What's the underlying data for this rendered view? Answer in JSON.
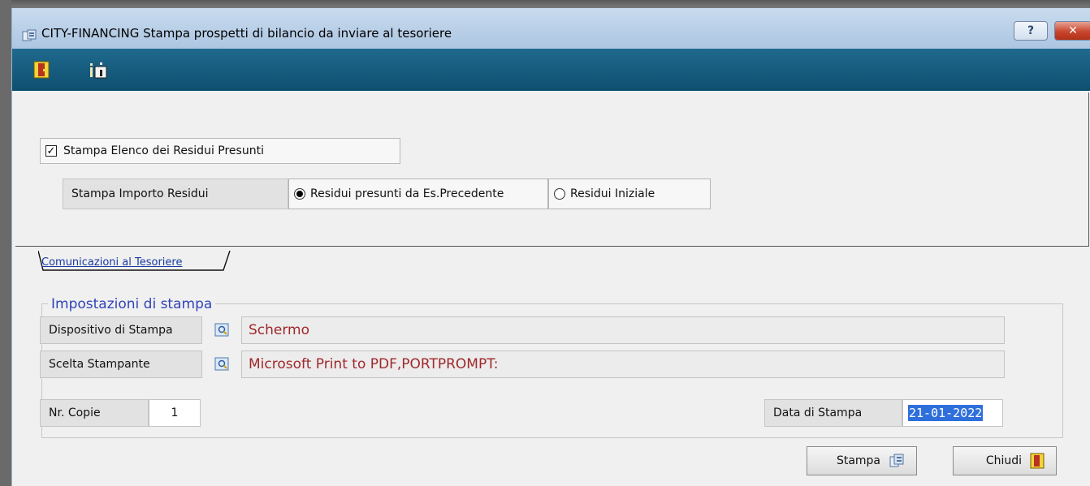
{
  "window": {
    "title": "CITY-FINANCING  Stampa prospetti di bilancio da inviare al tesoriere",
    "help_label": "?",
    "close_label": "✕"
  },
  "toolbar": {
    "items": [
      {
        "name": "exit-door-icon"
      },
      {
        "name": "info-icon"
      }
    ]
  },
  "options": {
    "checkbox_label": "Stampa Elenco dei Residui Presunti",
    "checkbox_checked": true,
    "residui_label": "Stampa Importo Residui",
    "radio_options": [
      {
        "label": "Residui presunti da Es.Precedente",
        "selected": true
      },
      {
        "label": "Residui Iniziale",
        "selected": false
      }
    ]
  },
  "tab": {
    "label": "Comunicazioni al Tesoriere"
  },
  "print_settings": {
    "title": "Impostazioni di stampa",
    "device_label": "Dispositivo di Stampa",
    "device_value": "Schermo",
    "printer_label": "Scelta Stampante",
    "printer_value": "Microsoft Print to PDF,PORTPROMPT:",
    "copies_label": "Nr. Copie",
    "copies_value": "1",
    "date_label": "Data di Stampa",
    "date_value": "21-01-2022"
  },
  "buttons": {
    "print_label": "Stampa",
    "close_label": "Chiudi"
  },
  "colors": {
    "toolbar": "#0e4f70",
    "value_text": "#a0282c",
    "group_title": "#3144b8",
    "tab_text": "#1a3b9e",
    "selection": "#2f6fdc"
  }
}
